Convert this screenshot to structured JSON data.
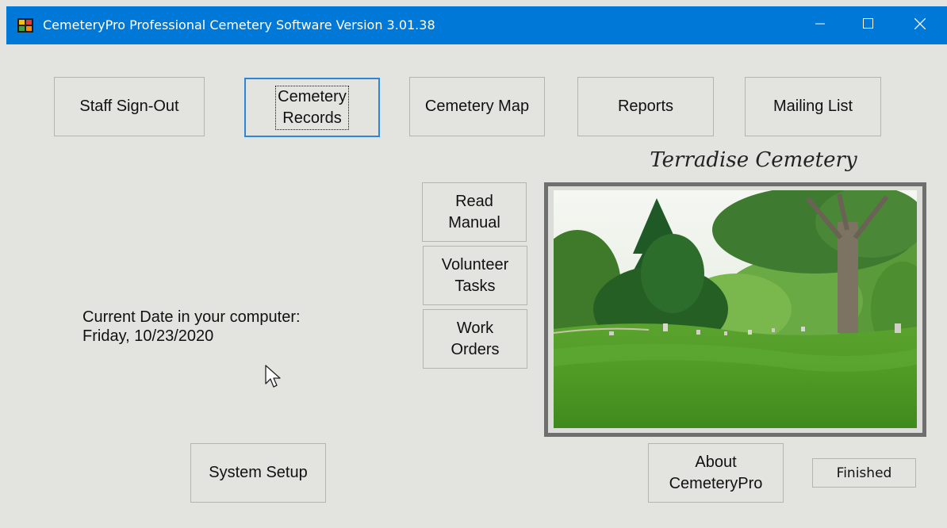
{
  "window": {
    "title": "CemeteryPro Professional Cemetery Software Version 3.01.38",
    "icon": "cemeterypro-app-icon",
    "controls": [
      "minimize-icon",
      "maximize-icon",
      "close-icon"
    ],
    "title_bar_color": "#0078d7",
    "background_color": "#e3e3df"
  },
  "nav": {
    "staff_sign_out": "Staff Sign-Out",
    "cemetery_records_line1": "Cemetery",
    "cemetery_records_line2": "Records",
    "cemetery_map": "Cemetery Map",
    "reports": "Reports",
    "mailing_list": "Mailing List"
  },
  "side": {
    "read_manual_line1": "Read",
    "read_manual_line2": "Manual",
    "volunteer_tasks_line1": "Volunteer",
    "volunteer_tasks_line2": "Tasks",
    "work_orders_line1": "Work",
    "work_orders_line2": "Orders"
  },
  "cemetery": {
    "name": "Terradise Cemetery",
    "photo": "cemetery-grounds-photo"
  },
  "date": {
    "label": "Current Date in your computer:",
    "value": "Friday, 10/23/2020"
  },
  "bottom": {
    "system_setup": "System Setup",
    "about_line1": "About",
    "about_line2": "CemeteryPro",
    "finished": "Finished"
  },
  "focus_color": "#2d86d8"
}
